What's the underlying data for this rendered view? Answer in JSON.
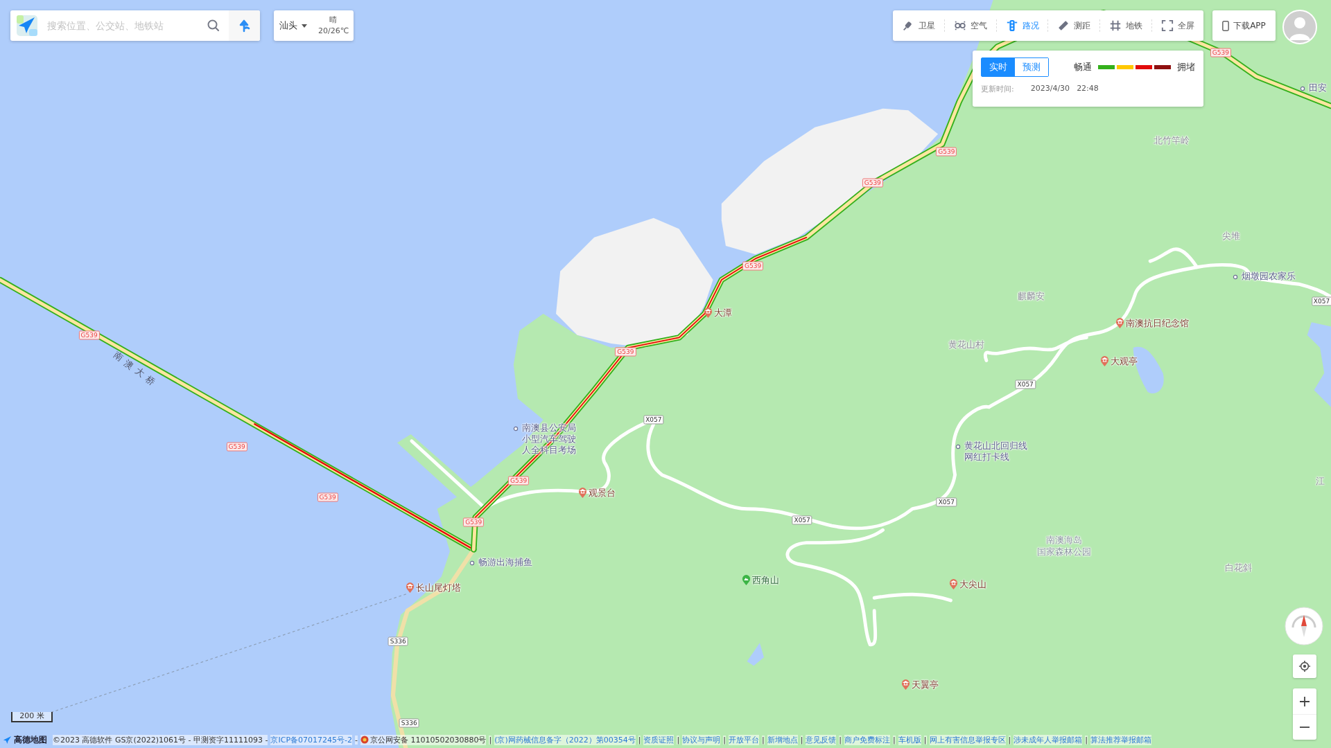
{
  "search": {
    "placeholder": "搜索位置、公交站、地铁站"
  },
  "city": {
    "name": "汕头",
    "weather": "晴",
    "temperature": "20/26℃"
  },
  "toolbar": [
    {
      "label": "卫星",
      "kind": "satellite",
      "selected": false
    },
    {
      "label": "空气",
      "kind": "air",
      "selected": false
    },
    {
      "label": "路况",
      "kind": "traffic",
      "selected": true
    },
    {
      "label": "测距",
      "kind": "ruler",
      "selected": false
    },
    {
      "label": "地铁",
      "kind": "subway",
      "selected": false
    },
    {
      "label": "全屏",
      "kind": "fullscreen",
      "selected": false
    }
  ],
  "download": {
    "label": "下载APP"
  },
  "traffic_panel": {
    "tabs": [
      {
        "label": "实时",
        "selected": true
      },
      {
        "label": "预测",
        "selected": false
      }
    ],
    "legend_start": "畅通",
    "legend_end": "拥堵",
    "legend_colors": [
      {
        "color": "#34b01c"
      },
      {
        "color": "#ffc800"
      },
      {
        "color": "#e20b0b"
      },
      {
        "color": "#8f1010"
      }
    ],
    "update_label": "更新时间:",
    "update_date": "2023/4/30",
    "update_time": "22:48"
  },
  "map": {
    "bridge_label": "南澳大桥",
    "labels": [
      {
        "lines": [
          "田安"
        ],
        "kind": "dot"
      },
      {
        "lines": [
          "北竹竿岭"
        ],
        "kind": "place"
      },
      {
        "lines": [
          "尖堆"
        ],
        "kind": "place"
      },
      {
        "lines": [
          "烟墩园农家乐"
        ],
        "kind": "dot"
      },
      {
        "lines": [
          "麒麟安"
        ],
        "kind": "place"
      },
      {
        "lines": [
          "大潭"
        ],
        "kind": "scenic"
      },
      {
        "lines": [
          "南澳抗日纪念馆"
        ],
        "kind": "museum"
      },
      {
        "lines": [
          "黄花山村"
        ],
        "kind": "place"
      },
      {
        "lines": [
          "大观亭"
        ],
        "kind": "scenic"
      },
      {
        "lines": [
          "南澳县公安局",
          "小型汽车驾驶",
          "人全科目考场"
        ],
        "kind": "dot"
      },
      {
        "lines": [
          "黄花山北回归线",
          "网红打卡线"
        ],
        "kind": "dot"
      },
      {
        "lines": [
          "江"
        ],
        "kind": "place"
      },
      {
        "lines": [
          "观景台"
        ],
        "kind": "scenic"
      },
      {
        "lines": [
          "南澳海岛",
          "国家森林公园"
        ],
        "kind": "park"
      },
      {
        "lines": [
          "畅游出海捕鱼"
        ],
        "kind": "dot"
      },
      {
        "lines": [
          "白花斜"
        ],
        "kind": "place"
      },
      {
        "lines": [
          "长山尾灯塔"
        ],
        "kind": "scenic"
      },
      {
        "lines": [
          "西角山"
        ],
        "kind": "mountain"
      },
      {
        "lines": [
          "大尖山"
        ],
        "kind": "scenic"
      },
      {
        "lines": [
          "天翼亭"
        ],
        "kind": "scenic"
      }
    ],
    "road_shields": [
      {
        "text": "G539",
        "kind": "national"
      },
      {
        "text": "G539",
        "kind": "national"
      },
      {
        "text": "G539",
        "kind": "national"
      },
      {
        "text": "G539",
        "kind": "national"
      },
      {
        "text": "G539",
        "kind": "national"
      },
      {
        "text": "G539",
        "kind": "national"
      },
      {
        "text": "G539",
        "kind": "national"
      },
      {
        "text": "G539",
        "kind": "national"
      },
      {
        "text": "G539",
        "kind": "national"
      },
      {
        "text": "G539",
        "kind": "national"
      },
      {
        "text": "X057",
        "kind": "county"
      },
      {
        "text": "X057",
        "kind": "county"
      },
      {
        "text": "X057",
        "kind": "county"
      },
      {
        "text": "X057",
        "kind": "county"
      },
      {
        "text": "X057",
        "kind": "county"
      },
      {
        "text": "S336",
        "kind": "county"
      },
      {
        "text": "S336",
        "kind": "county"
      }
    ]
  },
  "scale": {
    "label": "200 米"
  },
  "footer": {
    "logo": "高德地图",
    "items": [
      {
        "text": "©2023 高德软件 GS京(2022)1061号 - 甲测资字11111093 -",
        "kind": "text"
      },
      {
        "text": "京ICP备07017245号-2",
        "kind": "link"
      },
      {
        "text": "-",
        "kind": "text"
      },
      {
        "text": "京公网安备 11010502030880号",
        "kind": "police"
      },
      {
        "text": "|",
        "kind": "text"
      },
      {
        "text": "(京)网药械信息备字（2022）第00354号",
        "kind": "link"
      },
      {
        "text": "|",
        "kind": "text"
      },
      {
        "text": "资质证照",
        "kind": "link"
      },
      {
        "text": "|",
        "kind": "text"
      },
      {
        "text": "协议与声明",
        "kind": "link"
      },
      {
        "text": "|",
        "kind": "text"
      },
      {
        "text": "开放平台",
        "kind": "link"
      },
      {
        "text": "|",
        "kind": "text"
      },
      {
        "text": "新增地点",
        "kind": "link"
      },
      {
        "text": "|",
        "kind": "text"
      },
      {
        "text": "意见反馈",
        "kind": "link"
      },
      {
        "text": "|",
        "kind": "text"
      },
      {
        "text": "商户免费标注",
        "kind": "link"
      },
      {
        "text": "|",
        "kind": "text"
      },
      {
        "text": "车机版",
        "kind": "link"
      },
      {
        "text": "|",
        "kind": "text"
      },
      {
        "text": "网上有害信息举报专区",
        "kind": "link"
      },
      {
        "text": "|",
        "kind": "text"
      },
      {
        "text": "涉未成年人举报邮箱",
        "kind": "link"
      },
      {
        "text": "|",
        "kind": "text"
      },
      {
        "text": "算法推荐举报邮箱",
        "kind": "link"
      }
    ]
  }
}
